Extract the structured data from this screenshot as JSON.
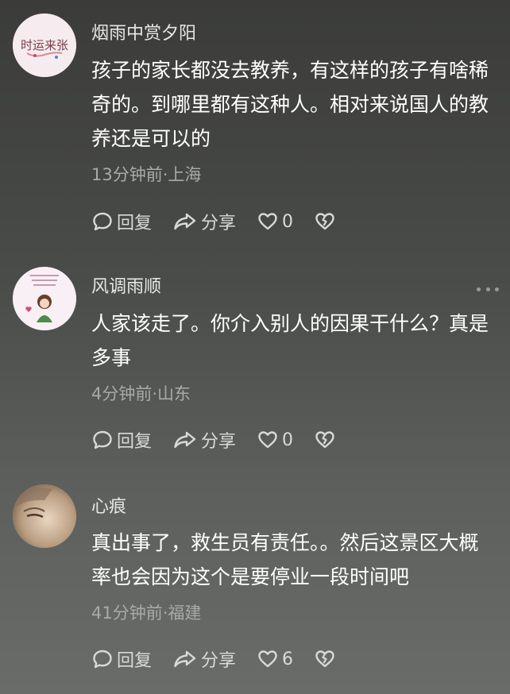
{
  "comments": [
    {
      "username": "烟雨中赏夕阳",
      "content": "孩子的家长都没去教养，有这样的孩子有啥稀奇的。到哪里都有这种人。相对来说国人的教养还是可以的",
      "meta": "13分钟前·上海",
      "avatar_text": "时运来张",
      "reply_label": "回复",
      "share_label": "分享",
      "likes": "0"
    },
    {
      "username": "风调雨顺",
      "content": "人家该走了。你介入别人的因果干什么？真是多事",
      "meta": "4分钟前·山东",
      "avatar_text": "",
      "reply_label": "回复",
      "share_label": "分享",
      "likes": "0"
    },
    {
      "username": "心痕",
      "content": "真出事了，救生员有责任。。然后这景区大概率也会因为这个是要停业一段时间吧",
      "meta": "41分钟前·福建",
      "avatar_text": "",
      "reply_label": "回复",
      "share_label": "分享",
      "likes": "6"
    }
  ],
  "icons": {
    "reply": "comment-bubble-icon",
    "share": "share-arrow-icon",
    "like": "heart-icon",
    "dislike": "broken-heart-icon",
    "more": "more-dots-icon"
  }
}
